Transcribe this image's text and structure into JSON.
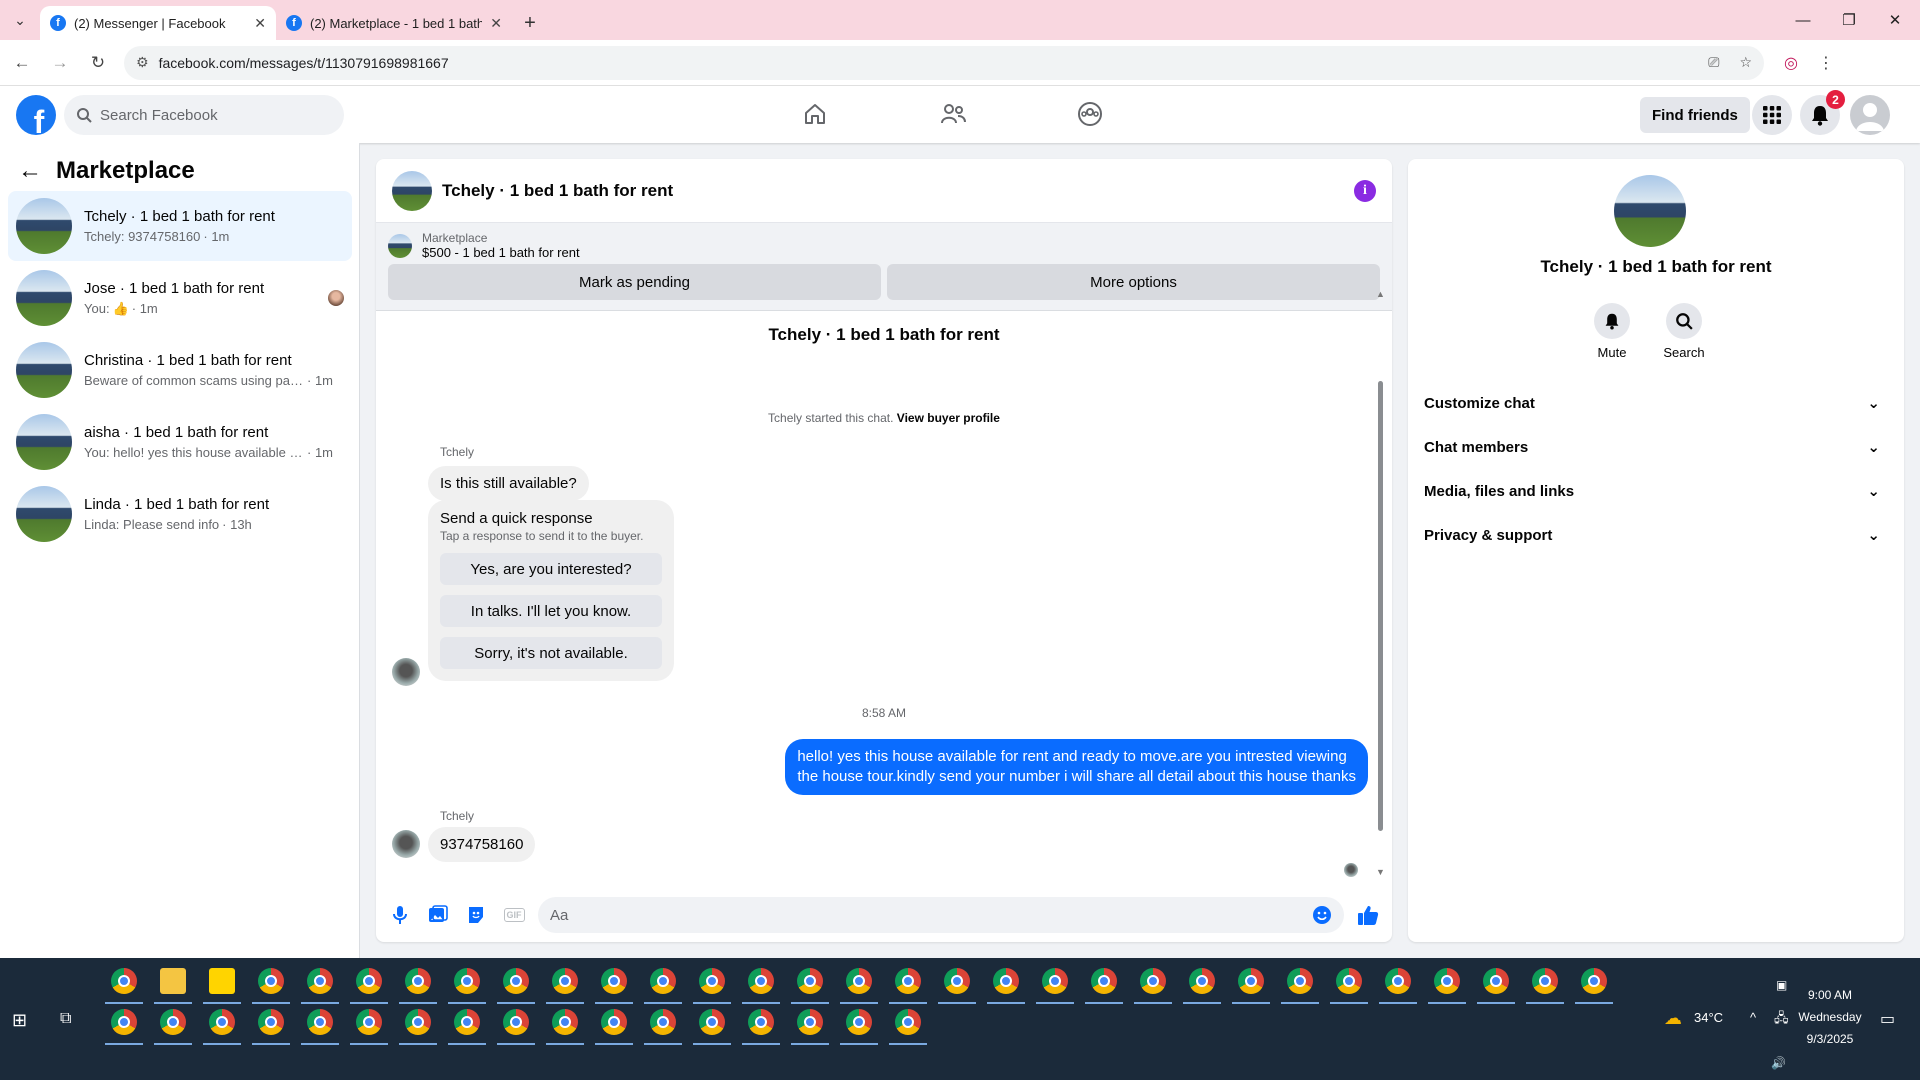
{
  "browser": {
    "tabs": [
      {
        "title": "(2) Messenger | Facebook",
        "active": true
      },
      {
        "title": "(2) Marketplace - 1 bed 1 bath f",
        "active": false
      }
    ],
    "url": "facebook.com/messages/t/1130791698981667"
  },
  "header": {
    "search_placeholder": "Search Facebook",
    "find_friends": "Find friends",
    "notification_count": "2"
  },
  "left": {
    "title": "Marketplace",
    "conversations": [
      {
        "name": "Tchely · 1 bed 1 bath for rent",
        "preview": "Tchely: 9374758160",
        "time": "· 1m",
        "selected": true
      },
      {
        "name": "Jose · 1 bed 1 bath for rent",
        "preview": "You:",
        "time": "· 1m",
        "selected": false
      },
      {
        "name": "Christina · 1 bed 1 bath for rent",
        "preview": "Beware of common scams using pay...",
        "time": "· 1m",
        "selected": false
      },
      {
        "name": "aisha · 1 bed 1 bath for rent",
        "preview": "You: hello! yes this house available fo...",
        "time": "· 1m",
        "selected": false
      },
      {
        "name": "Linda · 1 bed 1 bath for rent",
        "preview": "Linda: Please send info",
        "time": "· 13h",
        "selected": false
      }
    ]
  },
  "chat": {
    "title": "Tchely · 1 bed 1 bath for rent",
    "marketplace_label": "Marketplace",
    "listing": "$500 - 1 bed 1 bath for rent",
    "mark_pending": "Mark as pending",
    "more_options": "More options",
    "thread_title": "Tchely · 1 bed 1 bath for rent",
    "started_text": "Tchely started this chat.",
    "view_profile": "View buyer profile",
    "sender1": "Tchely",
    "msg1": "Is this still available?",
    "quick_title": "Send a quick response",
    "quick_sub": "Tap a response to send it to the buyer.",
    "quick_options": [
      "Yes, are you interested?",
      "In talks. I'll let you know.",
      "Sorry, it's not available."
    ],
    "timestamp": "8:58 AM",
    "my_msg_line1": "hello! yes this house available for rent and ready to move.are you intrested viewing",
    "my_msg_line2": "the house tour.kindly send your number i will share all detail about this house thanks",
    "sender2": "Tchely",
    "msg2": "9374758160",
    "input_placeholder": "Aa"
  },
  "right": {
    "title": "Tchely · 1 bed 1 bath for rent",
    "mute": "Mute",
    "search": "Search",
    "sections": [
      "Customize chat",
      "Chat members",
      "Media, files and links",
      "Privacy & support"
    ]
  },
  "taskbar": {
    "temperature": "34°C",
    "time": "9:00 AM",
    "day": "Wednesday",
    "date": "9/3/2025"
  }
}
